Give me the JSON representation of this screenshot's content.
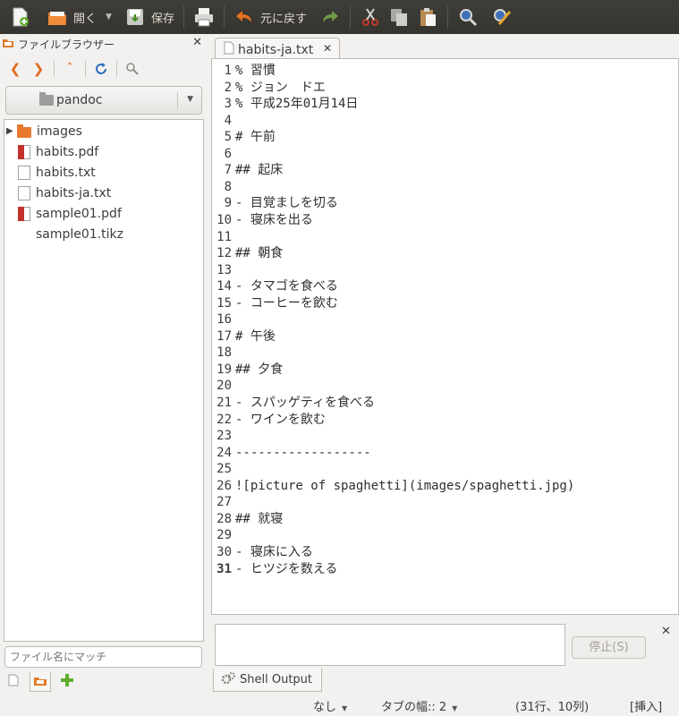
{
  "toolbar": {
    "open_label": "開く",
    "save_label": "保存",
    "undo_label": "元に戻す"
  },
  "sidebar": {
    "title": "ファイルブラウザー",
    "folder": "pandoc",
    "files": [
      {
        "name": "images",
        "type": "folder"
      },
      {
        "name": "habits.pdf",
        "type": "pdf"
      },
      {
        "name": "habits.txt",
        "type": "text"
      },
      {
        "name": "habits-ja.txt",
        "type": "text"
      },
      {
        "name": "sample01.pdf",
        "type": "pdf"
      },
      {
        "name": "sample01.tikz",
        "type": "none"
      }
    ],
    "filter_placeholder": "ファイル名にマッチ"
  },
  "editor": {
    "tab_label": "habits-ja.txt",
    "current_line": 31,
    "lines": [
      "% 習慣",
      "% ジョン　ドエ",
      "% 平成25年01月14日",
      "",
      "# 午前",
      "",
      "## 起床",
      "",
      "- 目覚ましを切る",
      "- 寝床を出る",
      "",
      "## 朝食",
      "",
      "- タマゴを食べる",
      "- コーヒーを飲む",
      "",
      "# 午後",
      "",
      "## 夕食",
      "",
      "- スパッゲティを食べる",
      "- ワインを飲む",
      "",
      "------------------",
      "",
      "![picture of spaghetti](images/spaghetti.jpg)",
      "",
      "## 就寝",
      "",
      "- 寝床に入る",
      "- ヒツジを数える"
    ]
  },
  "shell": {
    "stop_label": "停止(S)",
    "tab_label": "Shell Output"
  },
  "status": {
    "highlight_mode": "なし",
    "tab_width": "タブの幅:: 2",
    "position": "(31行、10列)",
    "insert_mode": "[挿入]"
  }
}
